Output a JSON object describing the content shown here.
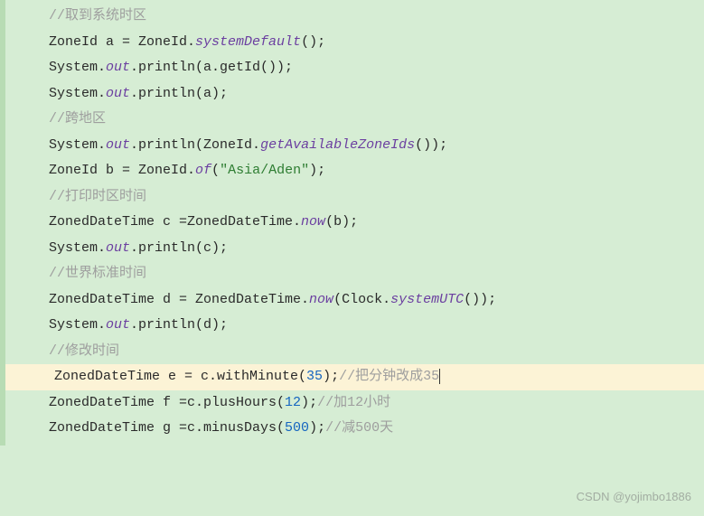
{
  "lines": [
    {
      "type": "comment",
      "text": "//取到系统时区"
    },
    {
      "type": "code",
      "tokens": [
        {
          "t": "plain",
          "v": "ZoneId a = ZoneId."
        },
        {
          "t": "static",
          "v": "systemDefault"
        },
        {
          "t": "plain",
          "v": "();"
        }
      ]
    },
    {
      "type": "code",
      "tokens": [
        {
          "t": "plain",
          "v": "System."
        },
        {
          "t": "static",
          "v": "out"
        },
        {
          "t": "plain",
          "v": ".println(a.getId());"
        }
      ]
    },
    {
      "type": "code",
      "tokens": [
        {
          "t": "plain",
          "v": "System."
        },
        {
          "t": "static",
          "v": "out"
        },
        {
          "t": "plain",
          "v": ".println(a);"
        }
      ]
    },
    {
      "type": "comment",
      "text": "//跨地区"
    },
    {
      "type": "code",
      "tokens": [
        {
          "t": "plain",
          "v": "System."
        },
        {
          "t": "static",
          "v": "out"
        },
        {
          "t": "plain",
          "v": ".println(ZoneId."
        },
        {
          "t": "static",
          "v": "getAvailableZoneIds"
        },
        {
          "t": "plain",
          "v": "());"
        }
      ]
    },
    {
      "type": "code",
      "tokens": [
        {
          "t": "plain",
          "v": "ZoneId b = ZoneId."
        },
        {
          "t": "static",
          "v": "of"
        },
        {
          "t": "plain",
          "v": "("
        },
        {
          "t": "string",
          "v": "\"Asia/Aden\""
        },
        {
          "t": "plain",
          "v": ");"
        }
      ]
    },
    {
      "type": "comment",
      "text": "//打印时区时间"
    },
    {
      "type": "code",
      "tokens": [
        {
          "t": "plain",
          "v": "ZonedDateTime c =ZonedDateTime."
        },
        {
          "t": "static",
          "v": "now"
        },
        {
          "t": "plain",
          "v": "(b);"
        }
      ]
    },
    {
      "type": "code",
      "tokens": [
        {
          "t": "plain",
          "v": "System."
        },
        {
          "t": "static",
          "v": "out"
        },
        {
          "t": "plain",
          "v": ".println(c);"
        }
      ]
    },
    {
      "type": "comment",
      "text": "//世界标准时间"
    },
    {
      "type": "code",
      "tokens": [
        {
          "t": "plain",
          "v": "ZonedDateTime d = ZonedDateTime."
        },
        {
          "t": "static",
          "v": "now"
        },
        {
          "t": "plain",
          "v": "(Clock."
        },
        {
          "t": "static",
          "v": "systemUTC"
        },
        {
          "t": "plain",
          "v": "());"
        }
      ]
    },
    {
      "type": "code",
      "tokens": [
        {
          "t": "plain",
          "v": "System."
        },
        {
          "t": "static",
          "v": "out"
        },
        {
          "t": "plain",
          "v": ".println(d);"
        }
      ]
    },
    {
      "type": "comment",
      "text": "//修改时间"
    },
    {
      "type": "code",
      "highlight": true,
      "tokens": [
        {
          "t": "plain",
          "v": "ZonedDateTime e = c.withMinute("
        },
        {
          "t": "number",
          "v": "35"
        },
        {
          "t": "plain",
          "v": ");"
        },
        {
          "t": "comment",
          "v": "//把分钟改成35"
        },
        {
          "t": "cursor",
          "v": ""
        }
      ]
    },
    {
      "type": "code",
      "tokens": [
        {
          "t": "plain",
          "v": "ZonedDateTime f =c.plusHours("
        },
        {
          "t": "number",
          "v": "12"
        },
        {
          "t": "plain",
          "v": ");"
        },
        {
          "t": "comment",
          "v": "//加12小时"
        }
      ]
    },
    {
      "type": "code",
      "tokens": [
        {
          "t": "plain",
          "v": "ZonedDateTime g =c.minusDays("
        },
        {
          "t": "number",
          "v": "500"
        },
        {
          "t": "plain",
          "v": ");"
        },
        {
          "t": "comment",
          "v": "//减500天"
        }
      ]
    }
  ],
  "watermark": "CSDN @yojimbo1886"
}
